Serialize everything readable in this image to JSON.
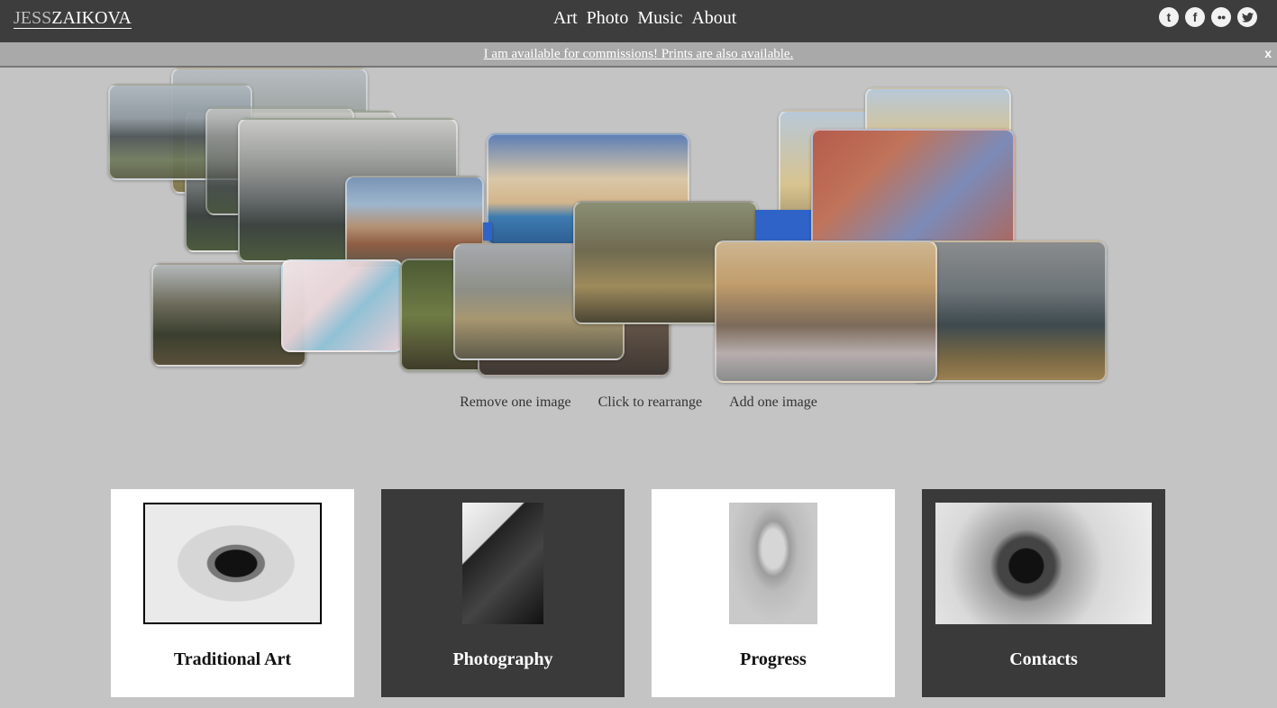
{
  "header": {
    "logo_first": "JESS",
    "logo_last": "ZAIKOVA",
    "nav": [
      "Art",
      "Photo",
      "Music",
      "About"
    ],
    "social": [
      {
        "icon": "tumblr-icon",
        "glyph": "t"
      },
      {
        "icon": "facebook-icon",
        "glyph": "f"
      },
      {
        "icon": "flickr-icon",
        "glyph": "••"
      },
      {
        "icon": "twitter-icon",
        "glyph": "🐦"
      }
    ]
  },
  "banner": {
    "text": "I am available for commissions! Prints are also available.",
    "close": "x"
  },
  "collage": {
    "controls": [
      "Remove one image",
      "Click to rearrange",
      "Add one image"
    ]
  },
  "cards": [
    {
      "label": "Traditional Art",
      "theme": "light"
    },
    {
      "label": "Photography",
      "theme": "dark"
    },
    {
      "label": "Progress",
      "theme": "light"
    },
    {
      "label": "Contacts",
      "theme": "dark"
    }
  ]
}
